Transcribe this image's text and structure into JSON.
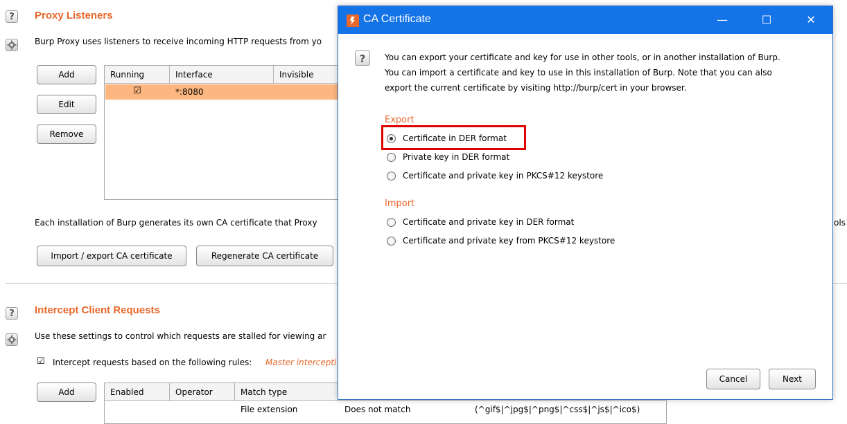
{
  "proxy_listeners": {
    "title": "Proxy Listeners",
    "description": "Burp Proxy uses listeners to receive incoming HTTP requests from yo",
    "buttons": {
      "add": "Add",
      "edit": "Edit",
      "remove": "Remove"
    },
    "columns": [
      "Running",
      "Interface",
      "Invisible"
    ],
    "rows": [
      {
        "running_checked": "☑",
        "interface": "*:8080",
        "invisible": ""
      }
    ],
    "ca_text": "Each installation of Burp generates its own CA certificate that Proxy",
    "ca_text_right": "ols",
    "import_export_button": "Import / export CA certificate",
    "regenerate_button": "Regenerate CA certificate"
  },
  "intercept_client": {
    "title": "Intercept Client Requests",
    "description": "Use these settings to control which requests are stalled for viewing ar",
    "checkbox_label": "Intercept requests based on the following rules:",
    "master_label": "Master intercepti",
    "add_button": "Add",
    "columns": [
      "Enabled",
      "Operator",
      "Match type"
    ],
    "row_partial": {
      "match_type": "File extension",
      "relationship": "Does not match",
      "condition": "(^gif$|^jpg$|^png$|^css$|^js$|^ico$)"
    }
  },
  "dialog": {
    "title": "CA Certificate",
    "controls": {
      "minimize": "—",
      "maximize": "☐",
      "close": "✕"
    },
    "info_lines": [
      "You can export your certificate and key for use in other tools, or in another installation of Burp.",
      "You can import a certificate and key to use in this installation of Burp. Note that you can also",
      "export the current certificate by visiting http://burp/cert in your browser."
    ],
    "export_label": "Export",
    "export_options": [
      "Certificate in DER format",
      "Private key in DER format",
      "Certificate and private key in PKCS#12 keystore"
    ],
    "import_label": "Import",
    "import_options": [
      "Certificate and private key in DER format",
      "Certificate and private key from PKCS#12 keystore"
    ],
    "selected_option": "Certificate in DER format",
    "cancel_button": "Cancel",
    "next_button": "Next",
    "highlight_color": "#e00000"
  },
  "colors": {
    "accent": "#e8672a",
    "titlebar": "#1473e6",
    "selected_row": "#fdb67f"
  },
  "icons": {
    "help": "?",
    "settings": "gear-icon",
    "app": "burp-logo-icon"
  }
}
